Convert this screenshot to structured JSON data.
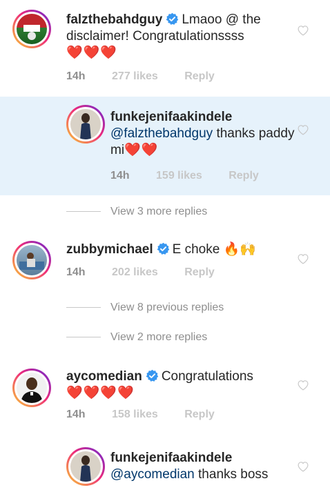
{
  "comments": [
    {
      "username": "falzthebahdguy",
      "verified": true,
      "text": "Lmaoo @ the disclaimer! Congratulationssss",
      "hearts": "❤️❤️❤️",
      "time": "14h",
      "likes": "277 likes",
      "reply": "Reply"
    },
    {
      "username": "funkejenifaakindele",
      "verified": false,
      "mention": "@falzthebahdguy",
      "text": " thanks paddy mi",
      "hearts": "❤️❤️",
      "time": "14h",
      "likes": "159 likes",
      "reply": "Reply"
    },
    {
      "username": "zubbymichael",
      "verified": true,
      "text": "E choke 🔥🙌",
      "time": "14h",
      "likes": "202 likes",
      "reply": "Reply"
    },
    {
      "username": "aycomedian",
      "verified": true,
      "text": "Congratulations",
      "hearts": "❤️❤️❤️❤️",
      "time": "14h",
      "likes": "158 likes",
      "reply": "Reply"
    },
    {
      "username": "funkejenifaakindele",
      "verified": false,
      "mention": "@aycomedian",
      "text": " thanks boss"
    }
  ],
  "view_links": {
    "more1": "View 3 more replies",
    "prev": "View 8 previous replies",
    "more2": "View 2 more replies"
  },
  "colors": {
    "verified": "#3897f0",
    "highlight": "#e6f2fb",
    "mention": "#00376b"
  },
  "icons": {
    "like": "heart-outline-icon",
    "verified": "verified-badge-icon"
  }
}
